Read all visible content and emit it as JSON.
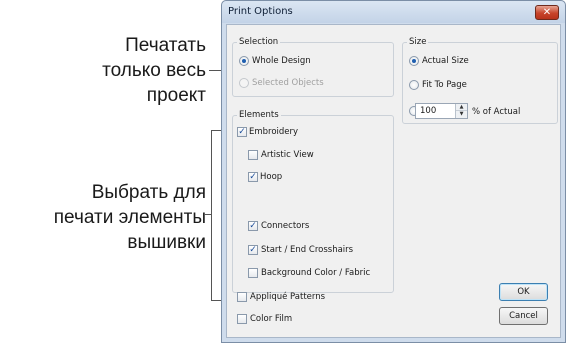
{
  "annotations": {
    "print_whole": [
      "Печатать",
      "только весь",
      "проект"
    ],
    "select_elements": [
      "Выбрать для",
      "печати элементы",
      "вышивки"
    ]
  },
  "dialog": {
    "title": "Print Options",
    "close_glyph": "✕",
    "selection": {
      "label": "Selection",
      "whole_design": "Whole Design",
      "selected_objects": "Selected Objects"
    },
    "size": {
      "label": "Size",
      "actual_size": "Actual Size",
      "fit_to_page": "Fit To Page",
      "percent_value": "100",
      "percent_suffix": "% of Actual"
    },
    "elements": {
      "label": "Elements",
      "embroidery": "Embroidery",
      "artistic_view": "Artistic View",
      "hoop": "Hoop",
      "connectors": "Connectors",
      "crosshairs": "Start / End Crosshairs",
      "background": "Background Color / Fabric",
      "applique": "Appliqué Patterns",
      "color_film": "Color Film"
    },
    "buttons": {
      "ok": "OK",
      "cancel": "Cancel"
    },
    "check_glyph": "✓",
    "spin_up": "▲",
    "spin_down": "▼"
  }
}
